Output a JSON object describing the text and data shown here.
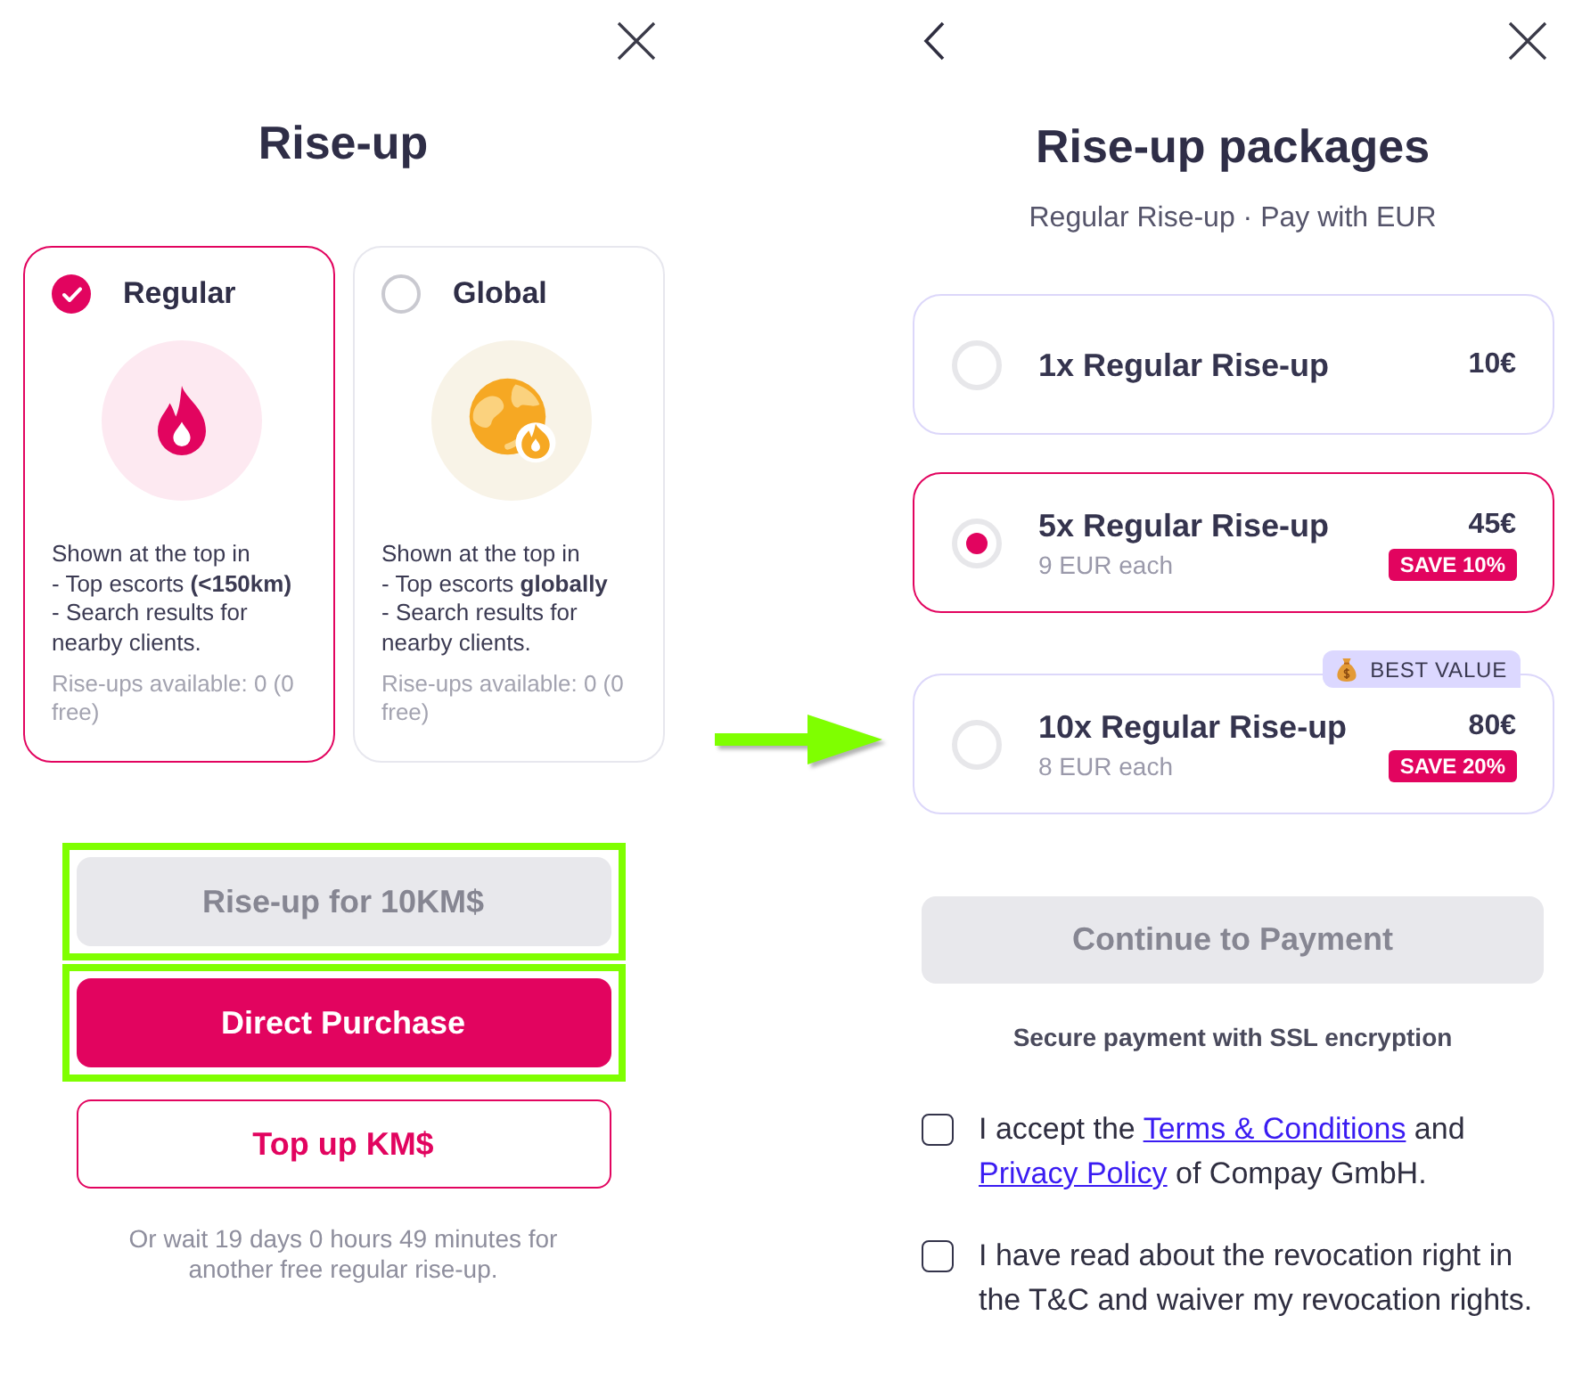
{
  "rise_up": {
    "title": "Rise-up",
    "options": [
      {
        "kind": "regular",
        "title": "Regular",
        "selected": true,
        "description": "Shown at the top in\n- Top escorts **(<150km)**\n- Search results for nearby clients.",
        "availability": "Rise-ups available: 0 (0 free)"
      },
      {
        "kind": "global",
        "title": "Global",
        "selected": false,
        "description": "Shown at the top in\n- Top escorts **globally**\n- Search results for nearby clients.",
        "availability": "Rise-ups available: 0 (0 free)"
      }
    ],
    "buttons": [
      {
        "kind": "primary",
        "label": "Rise-up for 10KM$",
        "disabled": true,
        "highlighted": true
      },
      {
        "kind": "primary",
        "label": "Direct Purchase",
        "disabled": false,
        "highlighted": true
      },
      {
        "kind": "outline",
        "label": "Top up KM$",
        "disabled": false,
        "highlighted": false
      }
    ],
    "wait_note": "Or wait 19 days 0 hours 49 minutes for another free regular rise-up."
  },
  "packages": {
    "title": "Rise-up packages",
    "subtitle": "Regular Rise-up · Pay with EUR",
    "items": [
      {
        "name": "1x Regular Rise-up",
        "price": "10€",
        "selected": false
      },
      {
        "name": "5x Regular Rise-up",
        "price": "45€",
        "unit_price": "9 EUR each",
        "discount": "SAVE 10%",
        "selected": true
      },
      {
        "name": "10x Regular Rise-up",
        "price": "80€",
        "unit_price": "8 EUR each",
        "discount": "SAVE 20%",
        "ribbon": "BEST VALUE",
        "selected": false
      }
    ],
    "continue_button": {
      "label": "Continue to Payment",
      "disabled": true
    },
    "security_note": "Secure payment with SSL encryption",
    "consents": [
      {
        "checked": false,
        "parts": [
          {
            "kind": "text",
            "text": "I accept the "
          },
          {
            "kind": "link",
            "text": "Terms & Conditions"
          },
          {
            "kind": "text",
            "text": " and "
          },
          {
            "kind": "link",
            "text": "Privacy Policy"
          },
          {
            "kind": "text",
            "text": " of Compay GmbH."
          }
        ]
      },
      {
        "checked": false,
        "parts": [
          {
            "kind": "text",
            "text": "I have read about the revocation right in the T&C and waiver my revocation rights."
          }
        ]
      }
    ]
  }
}
